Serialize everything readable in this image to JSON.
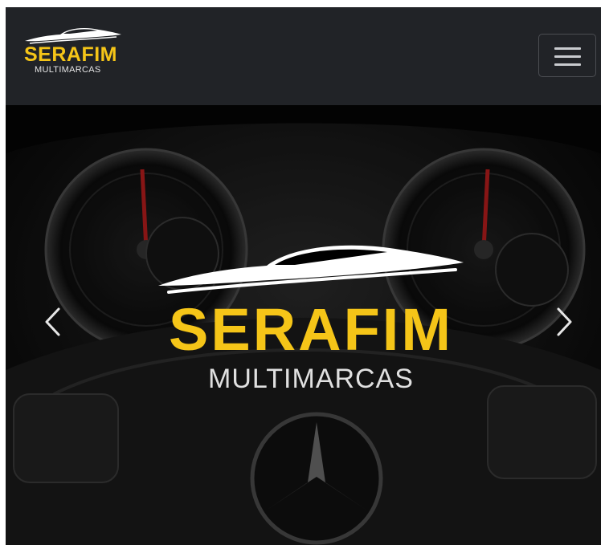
{
  "navbar": {
    "brand_name": "SERAFIM",
    "brand_subtitle": "MULTIMARCAS",
    "menu_icon": "hamburger-menu-icon"
  },
  "hero": {
    "logo_name": "SERAFIM",
    "logo_subtitle": "MULTIMARCAS",
    "prev_icon": "chevron-left-icon",
    "next_icon": "chevron-right-icon",
    "background": "car dashboard image"
  },
  "colors": {
    "navbar_bg": "#212327",
    "brand_yellow": "#f5c518",
    "subtitle_gray": "#e0e0e0"
  }
}
